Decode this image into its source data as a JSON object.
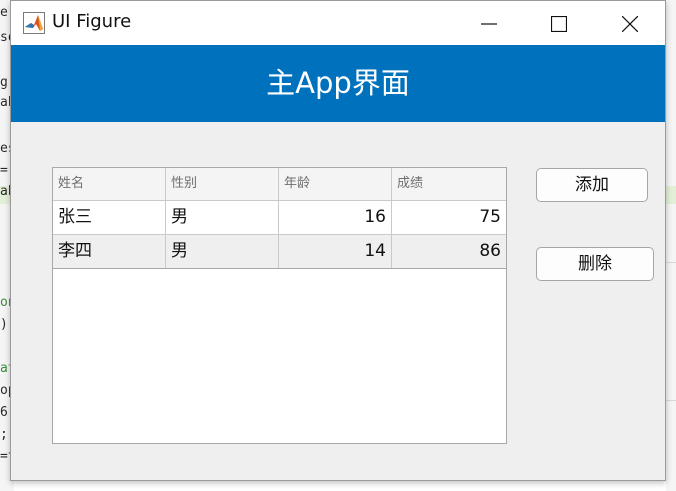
{
  "window": {
    "title": "UI Figure"
  },
  "header": {
    "title": "主App界面",
    "color": "#0072bd"
  },
  "table": {
    "columns": [
      "姓名",
      "性别",
      "年龄",
      "成绩"
    ],
    "rows": [
      {
        "name": "张三",
        "gender": "男",
        "age": "16",
        "score": "75"
      },
      {
        "name": "李四",
        "gender": "男",
        "age": "14",
        "score": "86"
      }
    ]
  },
  "buttons": {
    "add": "添加",
    "delete": "删除"
  },
  "background": {
    "fragments": [
      "e",
      "so",
      "g",
      "ab",
      "es",
      "=",
      "ab",
      "on",
      ")",
      "at",
      "op",
      "6",
      ";",
      "=t"
    ]
  }
}
